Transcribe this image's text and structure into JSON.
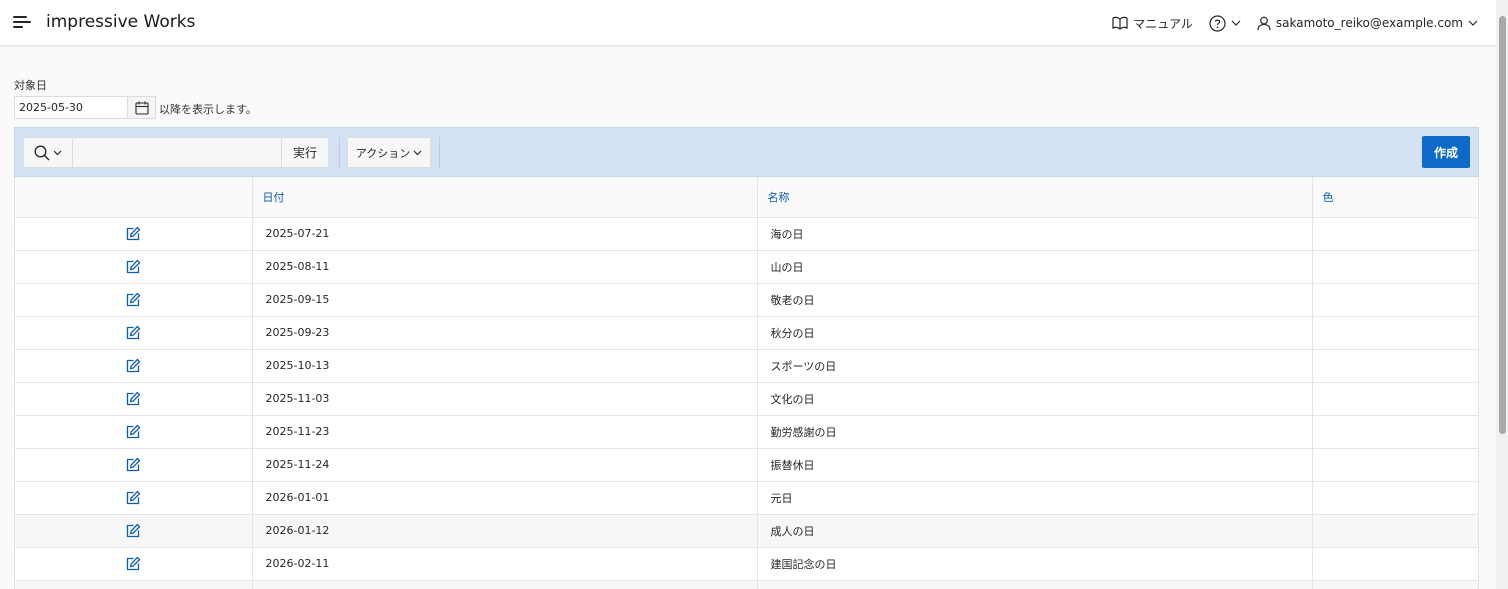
{
  "header": {
    "app_title": "impressive Works",
    "manual_label": "マニュアル",
    "user_label": "sakamoto_reiko@example.com"
  },
  "filter": {
    "label": "対象日",
    "date_value": "2025-05-30",
    "suffix": "以降を表示します。"
  },
  "toolbar": {
    "go_label": "実行",
    "actions_label": "アクション",
    "create_label": "作成",
    "search_value": ""
  },
  "table": {
    "columns": [
      "",
      "日付",
      "名称",
      "色"
    ],
    "rows": [
      {
        "date": "2025-07-21",
        "name": "海の日",
        "color": ""
      },
      {
        "date": "2025-08-11",
        "name": "山の日",
        "color": ""
      },
      {
        "date": "2025-09-15",
        "name": "敬老の日",
        "color": ""
      },
      {
        "date": "2025-09-23",
        "name": "秋分の日",
        "color": ""
      },
      {
        "date": "2025-10-13",
        "name": "スポーツの日",
        "color": ""
      },
      {
        "date": "2025-11-03",
        "name": "文化の日",
        "color": ""
      },
      {
        "date": "2025-11-23",
        "name": "勤労感謝の日",
        "color": ""
      },
      {
        "date": "2025-11-24",
        "name": "振替休日",
        "color": ""
      },
      {
        "date": "2026-01-01",
        "name": "元日",
        "color": ""
      },
      {
        "date": "2026-01-12",
        "name": "成人の日",
        "color": ""
      },
      {
        "date": "2026-02-11",
        "name": "建国記念の日",
        "color": ""
      },
      {
        "date": "",
        "name": "",
        "color": ""
      }
    ]
  },
  "colors": {
    "primary": "#0d6ac9",
    "toolbar_bg": "#d4e1f4",
    "header_link": "#0b5db3"
  },
  "icons": {
    "menu": "hamburger-icon",
    "manual": "book-icon",
    "help": "help-circle-icon",
    "user": "user-icon",
    "calendar": "calendar-icon",
    "search": "search-icon",
    "edit": "edit-icon"
  }
}
